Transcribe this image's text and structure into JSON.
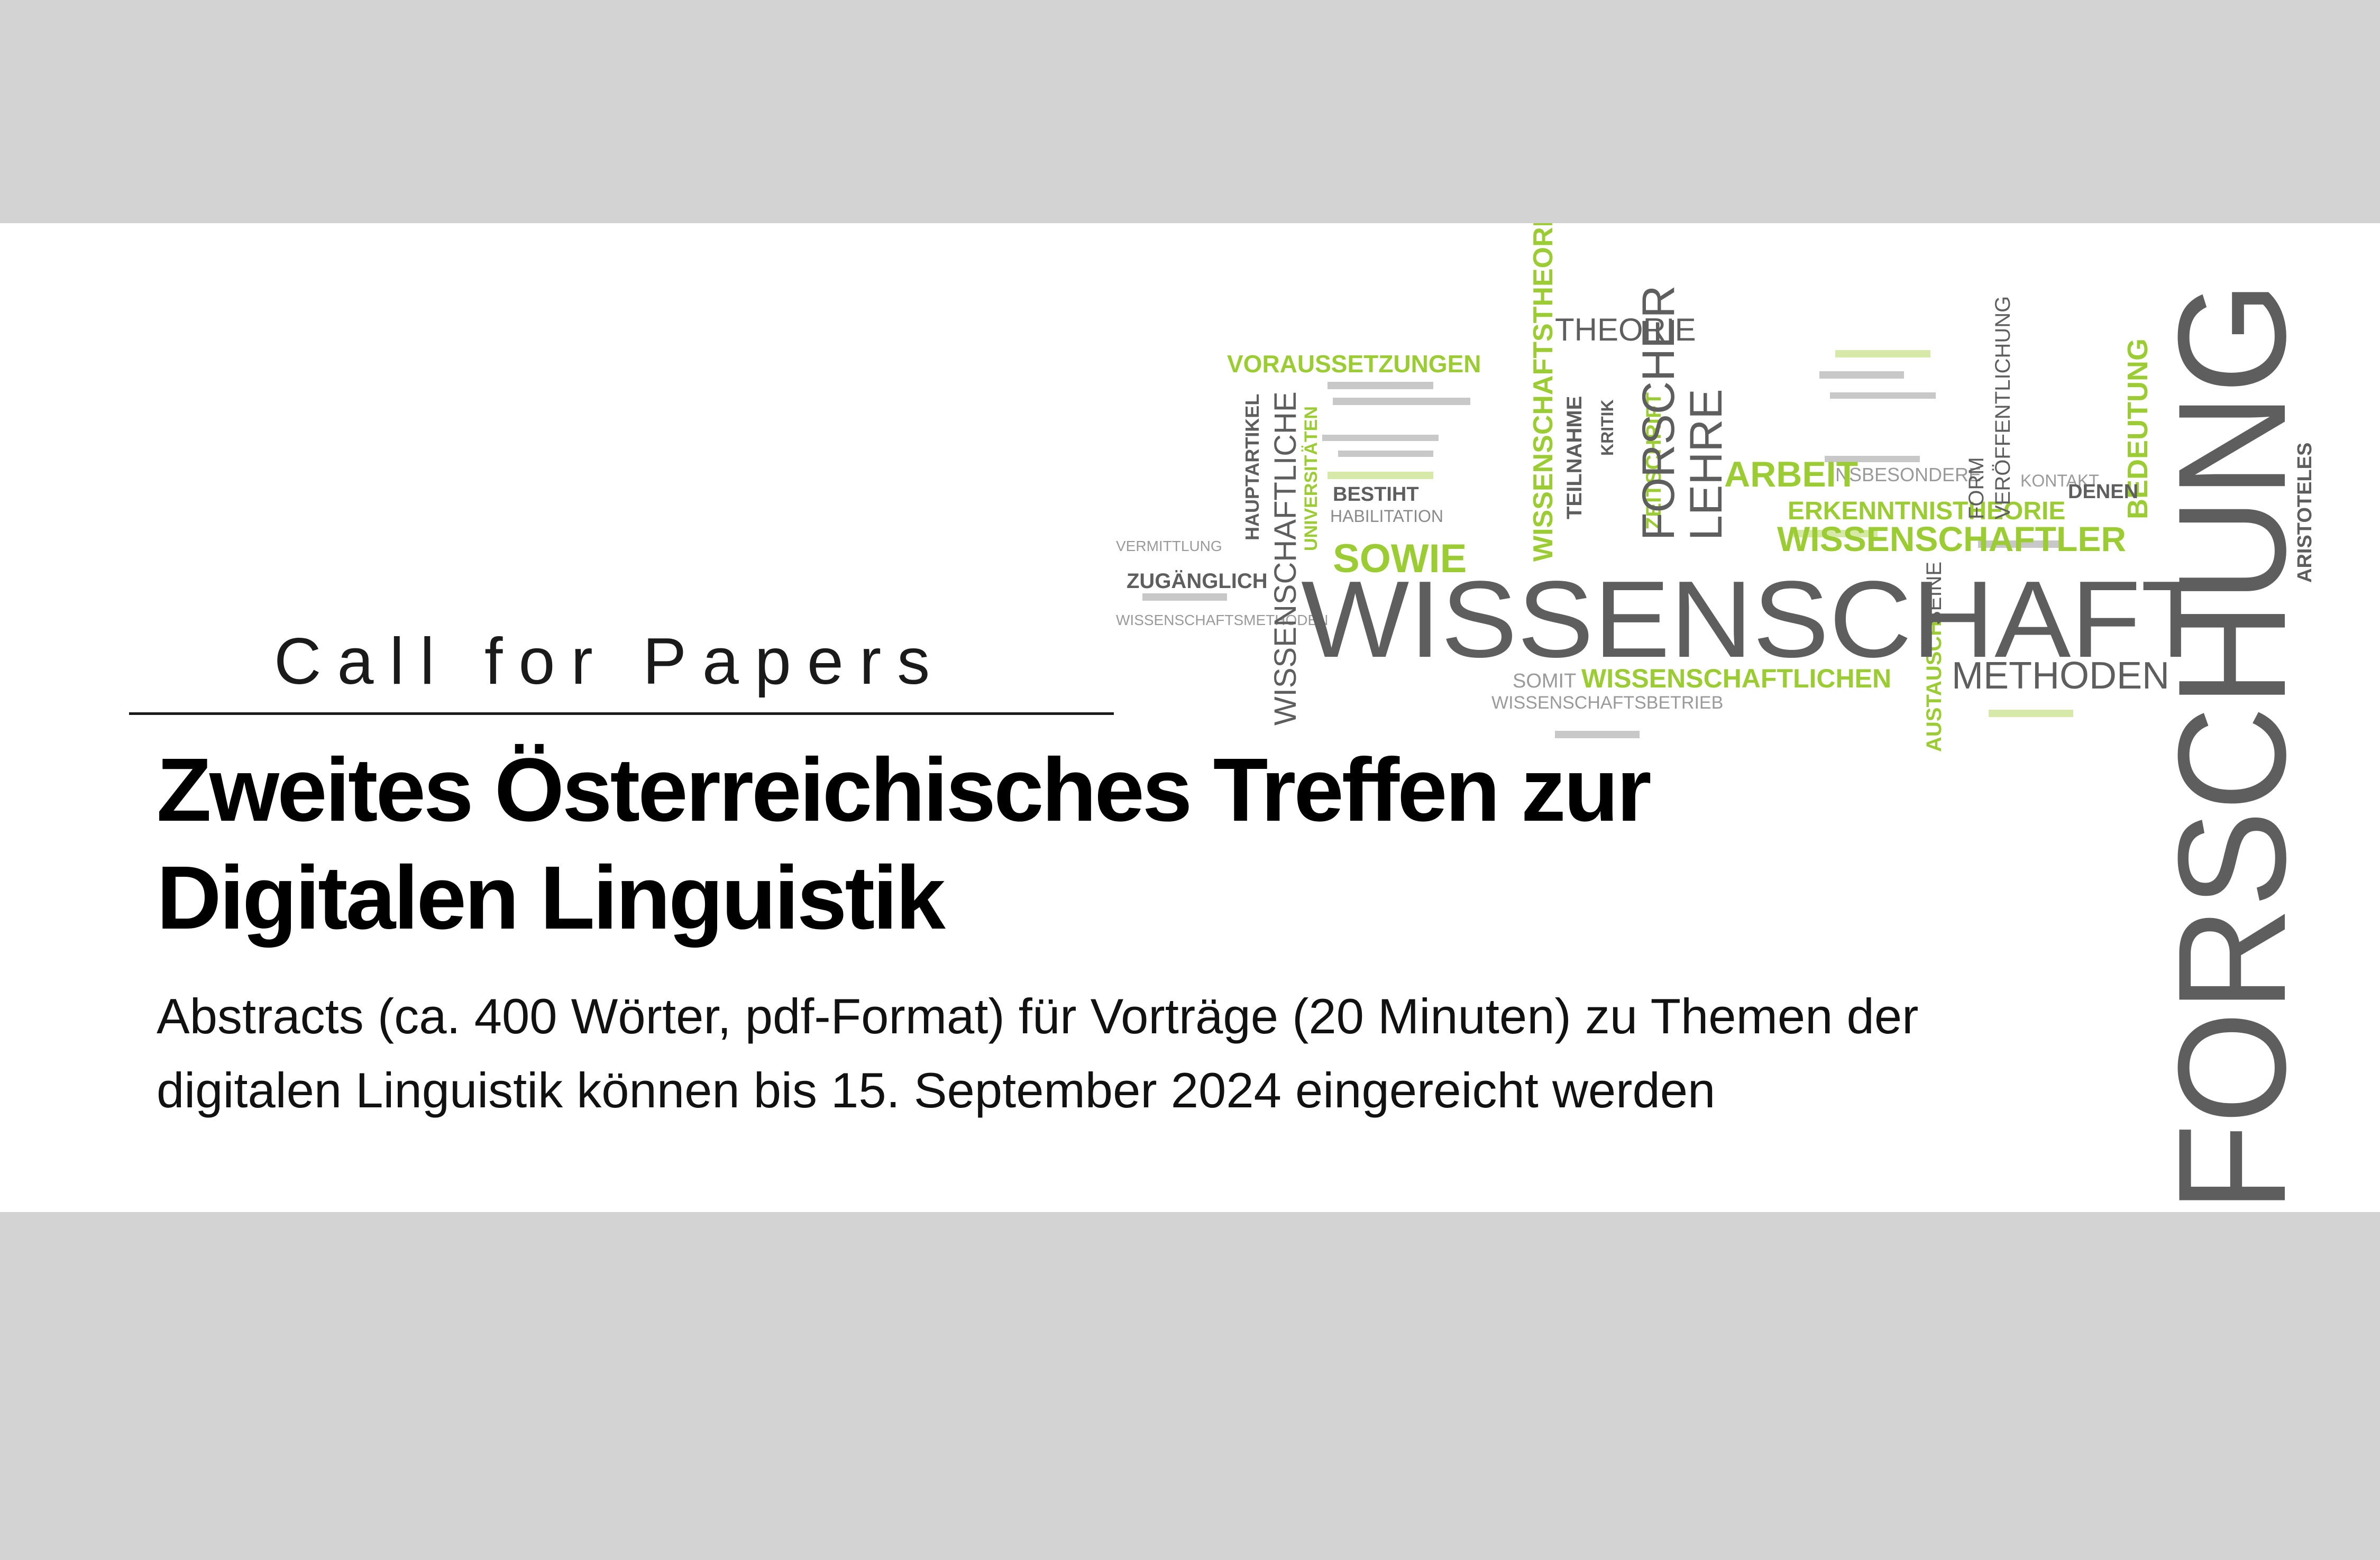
{
  "banner": {
    "label": "Call for Papers",
    "title": "Zweites Österreichisches Treffen zur Digitalen Linguistik",
    "abstract": "Abstracts (ca. 400 Wörter, pdf-Format) für Vorträge (20 Minuten) zu Themen der digitalen Linguistik können bis 15. September 2024 eingereicht werden"
  },
  "word_cloud": {
    "main_word": "WISSENSCHAFT",
    "vertical_word": "FORSCHUNG",
    "words": {
      "theorie": "THEORIE",
      "voraussetzungen": "VORAUSSETZUNGEN",
      "arbeit": "ARBEIT",
      "wissenschaftler": "WISSENSCHAFTLER",
      "erkenntnistheorie": "ERKENNTNISTHEORIE",
      "sowie": "SOWIE",
      "methoden": "METHODEN",
      "wissenschaftlichen": "WISSENSCHAFTLICHEN",
      "forscher": "FORSCHER",
      "lehre": "LEHRE",
      "wissenschaftstheorie": "WISSENSCHAFTSTHEORIE",
      "wissenschaftliche": "WISSENSCHAFTLICHE",
      "zugaenglich": "ZUGÄNGLICH",
      "bestiht": "BESTIHT",
      "habilitation": "HABILITATION",
      "hauptartikel": "HAUPTARTIKEL",
      "bedeutung": "BEDEUTUNG",
      "veroeffentlichung": "VERÖFFENTLICHUNG",
      "insbesondere": "INSBESONDERE",
      "wissenschaftsbetrieb": "WISSENSCHAFTSBETRIEB",
      "denen": "DENEN",
      "somit": "SOMIT",
      "teilnahme": "TEILNAHME",
      "aristoteles": "ARISTOTELES",
      "austausch": "AUSTAUSCH",
      "zeitschrift": "ZEITSCHRIFT",
      "universitaeten": "UNIVERSITÄTEN",
      "form": "FORM",
      "kritik": "KRITIK",
      "seine": "SEINE",
      "vermittlung": "VERMITTLUNG",
      "kontakt": "KONTAKT",
      "wissenschaftsmethoden": "WISSENSCHAFTSMETHODEN"
    },
    "colors": {
      "gray": "#5e5e5e",
      "green": "#9ccc34",
      "light_gray": "#8a8a8a"
    }
  }
}
